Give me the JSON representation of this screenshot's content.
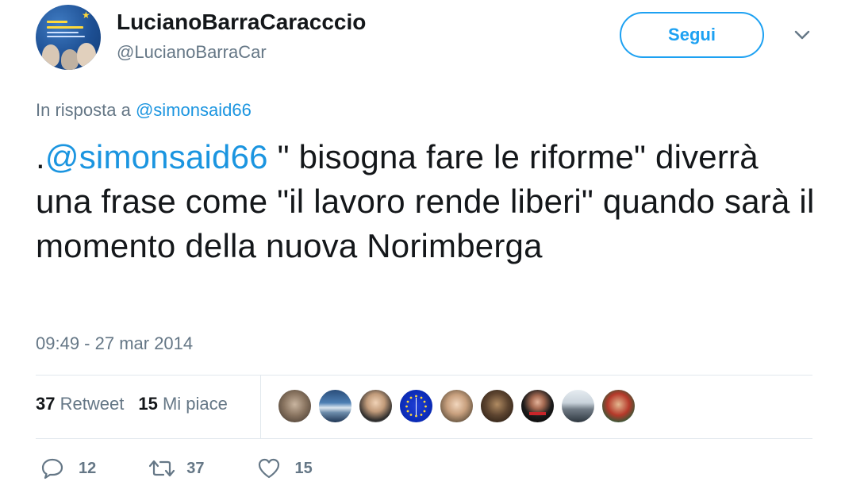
{
  "author": {
    "name": "LucianoBarraCaracccio",
    "handle": "@LucianoBarraCar"
  },
  "follow_button": {
    "label": "Segui"
  },
  "reply": {
    "prefix": "In risposta a",
    "mention": "@simonsaid66"
  },
  "tweet": {
    "lead": ".",
    "mention": "@simonsaid66",
    "body": " \" bisogna fare le riforme\" diverrà una frase come \"il lavoro rende liberi\" quando sarà il momento della nuova Norimberga"
  },
  "timestamp": "09:49 - 27 mar 2014",
  "stats": {
    "retweets_count": "37",
    "retweets_label": "Retweet",
    "likes_count": "15",
    "likes_label": "Mi piace"
  },
  "actions": {
    "reply_count": "12",
    "retweet_count": "37",
    "like_count": "15"
  },
  "colors": {
    "accent": "#1da1f2",
    "link": "#1b95e0",
    "muted": "#657786",
    "divider": "#e1e8ed"
  }
}
